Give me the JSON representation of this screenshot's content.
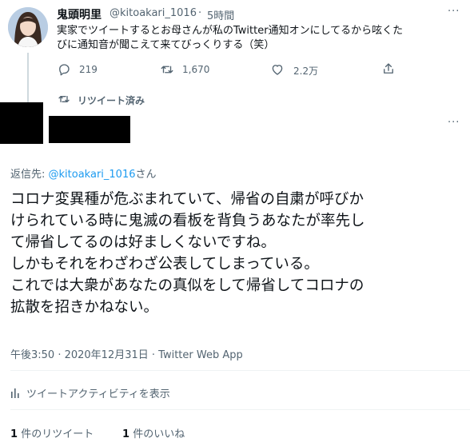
{
  "tweet1": {
    "display_name": "鬼頭明里",
    "handle": "@kitoakari_1016",
    "separator": "·",
    "time": "5時間",
    "more": "···",
    "text_lines": [
      "実家でツイートするとお母さんが私のTwitter通知オンにしてるから呟くた",
      "びに通知音が聞こえて来てびっくりする（笑）"
    ],
    "actions": {
      "reply_count": "219",
      "retweet_count": "1,670",
      "like_count": "2.2万"
    },
    "retweeted_label": "リツイート済み"
  },
  "tweet2": {
    "more": "···",
    "reply_prefix": "返信先: ",
    "reply_handle": "@kitoakari_1016",
    "reply_suffix": "さん",
    "text_lines": [
      "コロナ変異種が危ぶまれていて、帰省の自粛が呼びか",
      "けられている時に鬼滅の看板を背負うあなたが率先し",
      "て帰省してるのは好ましくないですね。",
      "しかもそれをわざわざ公表してしまっている。",
      "これでは大衆があなたの真似をして帰省してコロナの",
      "拡散を招きかねない。"
    ],
    "timestamp": "午後3:50 · 2020年12月31日 · Twitter Web App",
    "activity_label": "ツイートアクティビティを表示",
    "retweets_num": "1",
    "retweets_label": "件のリツイート",
    "likes_num": "1",
    "likes_label": "件のいいね"
  },
  "colors": {
    "primary_text": "#0f1419",
    "secondary_text": "#536471",
    "link": "#1d9bf0",
    "divider": "#eff3f4"
  }
}
